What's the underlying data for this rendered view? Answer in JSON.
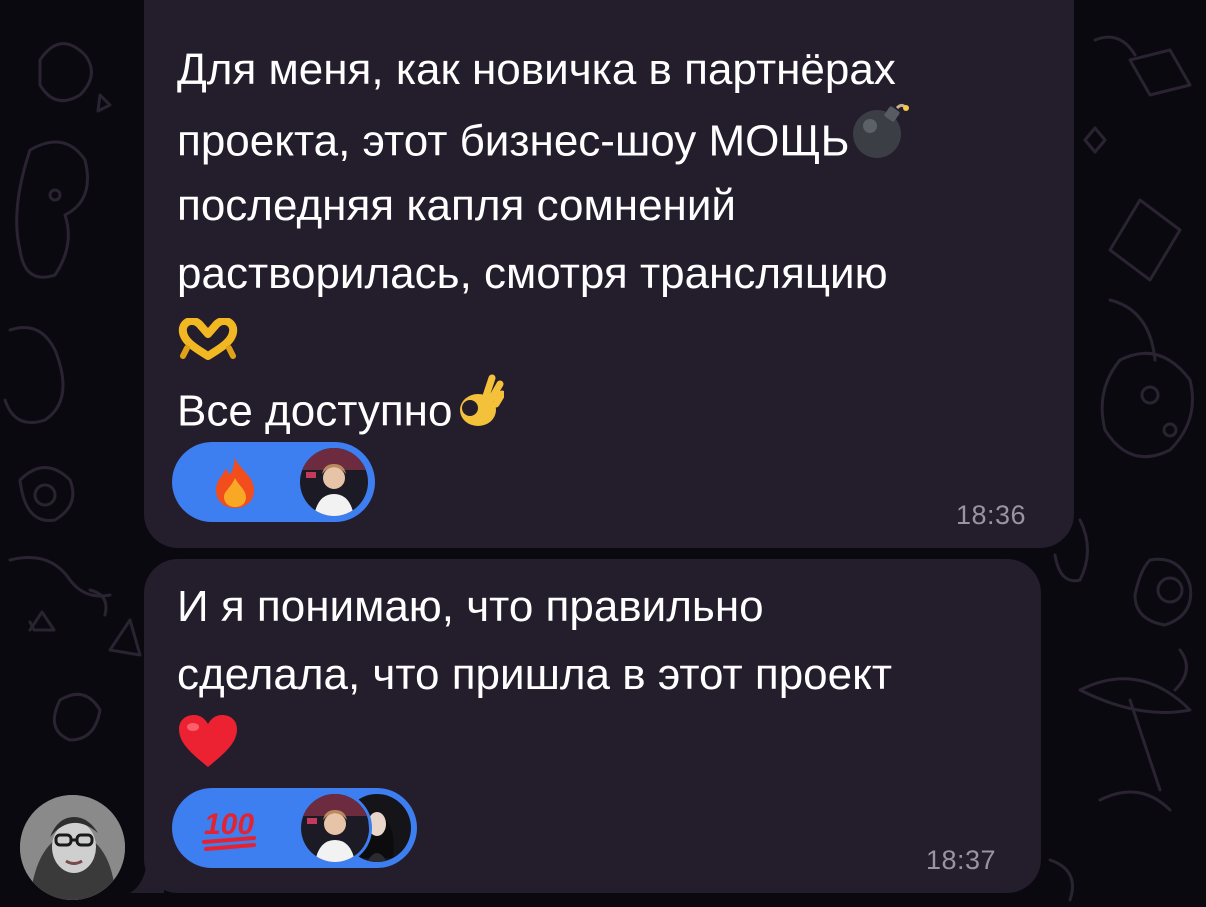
{
  "colors": {
    "background": "#0b0910",
    "bubble": "#241d2c",
    "reaction_pill": "#3d7ef0",
    "timestamp": "#9a93a3",
    "text": "#ffffff"
  },
  "messages": [
    {
      "lines": [
        "Для меня, как новичка в партнёрах",
        "проекта, этот бизнес-шоу МОЩЬ",
        "последняя капля сомнений",
        "растворилась, смотря трансляцию",
        "",
        "Все доступно"
      ],
      "emojis": [
        "bomb-emoji",
        "heart-hands-emoji",
        "ok-hand-emoji"
      ],
      "reactions": [
        {
          "emoji": "fire-emoji",
          "reacted_by": [
            "reactor-avatar-1"
          ]
        }
      ],
      "time": "18:36"
    },
    {
      "lines": [
        "И я понимаю, что правильно",
        "сделала, что пришла в этот проект",
        ""
      ],
      "emojis": [
        "red-heart-emoji"
      ],
      "reactions": [
        {
          "emoji": "hundred-points-emoji",
          "reacted_by": [
            "reactor-avatar-1",
            "reactor-avatar-2"
          ]
        }
      ],
      "time": "18:37"
    }
  ]
}
